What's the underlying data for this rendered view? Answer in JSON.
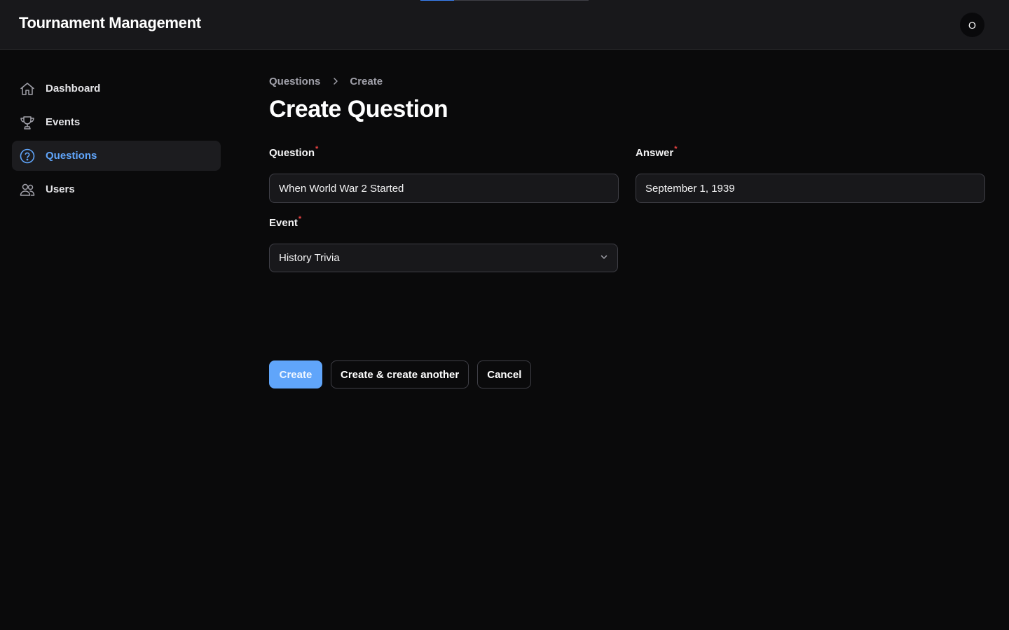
{
  "header": {
    "brand": "Tournament Management",
    "avatar_initial": "O",
    "progress_fraction": 0.2
  },
  "sidebar": {
    "items": [
      {
        "label": "Dashboard",
        "icon": "home-icon",
        "active": false
      },
      {
        "label": "Events",
        "icon": "trophy-icon",
        "active": false
      },
      {
        "label": "Questions",
        "icon": "question-circle-icon",
        "active": true
      },
      {
        "label": "Users",
        "icon": "users-icon",
        "active": false
      }
    ]
  },
  "breadcrumb": {
    "parent": "Questions",
    "current": "Create"
  },
  "page": {
    "title": "Create Question"
  },
  "form": {
    "question": {
      "label": "Question",
      "required_mark": "*",
      "value": "When World War 2 Started"
    },
    "answer": {
      "label": "Answer",
      "required_mark": "*",
      "value": "September 1, 1939"
    },
    "event": {
      "label": "Event",
      "required_mark": "*",
      "selected": "History Trivia"
    }
  },
  "actions": {
    "create": "Create",
    "create_another": "Create & create another",
    "cancel": "Cancel"
  },
  "colors": {
    "accent": "#60a5fa",
    "background": "#0a0a0b",
    "topbar": "#18181b",
    "required": "#ef4444"
  }
}
